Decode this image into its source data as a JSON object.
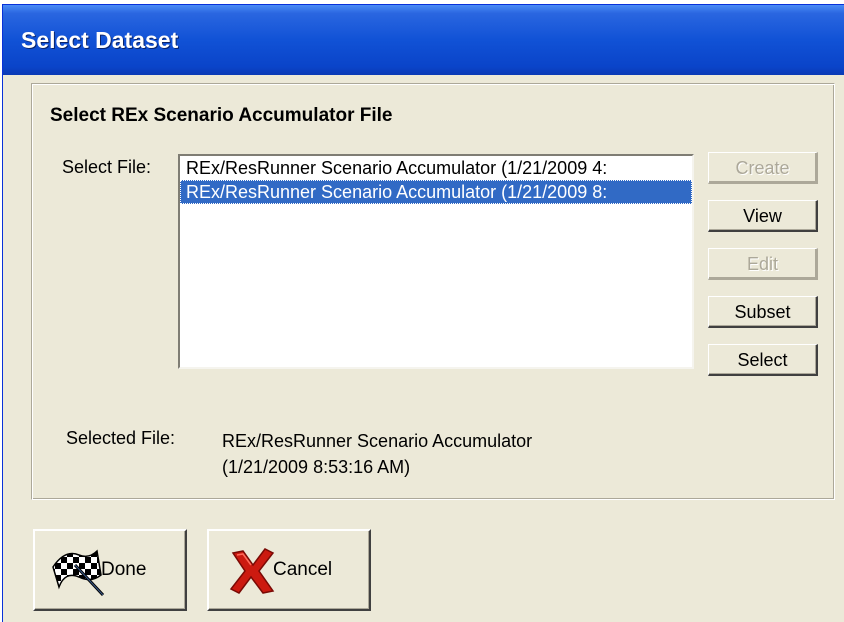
{
  "window": {
    "title": "Select Dataset"
  },
  "group": {
    "heading": "Select REx Scenario Accumulator File"
  },
  "file_list": {
    "label": "Select File:",
    "items": [
      {
        "text": "REx/ResRunner Scenario Accumulator (1/21/2009 4:",
        "selected": false
      },
      {
        "text": "REx/ResRunner Scenario Accumulator (1/21/2009 8:",
        "selected": true
      }
    ]
  },
  "side_buttons": {
    "create": "Create",
    "view": "View",
    "edit": "Edit",
    "subset": "Subset",
    "select": "Select"
  },
  "selected_file": {
    "label": "Selected File:",
    "line1": "REx/ResRunner Scenario Accumulator",
    "line2": "(1/21/2009 8:53:16 AM)"
  },
  "footer": {
    "done": "Done",
    "cancel": "Cancel"
  },
  "colors": {
    "titlebar": "#0a44c9",
    "selection": "#316ac5",
    "face": "#ece9d8"
  },
  "icons": {
    "done": "checkered-flag-icon",
    "cancel": "red-x-icon"
  }
}
